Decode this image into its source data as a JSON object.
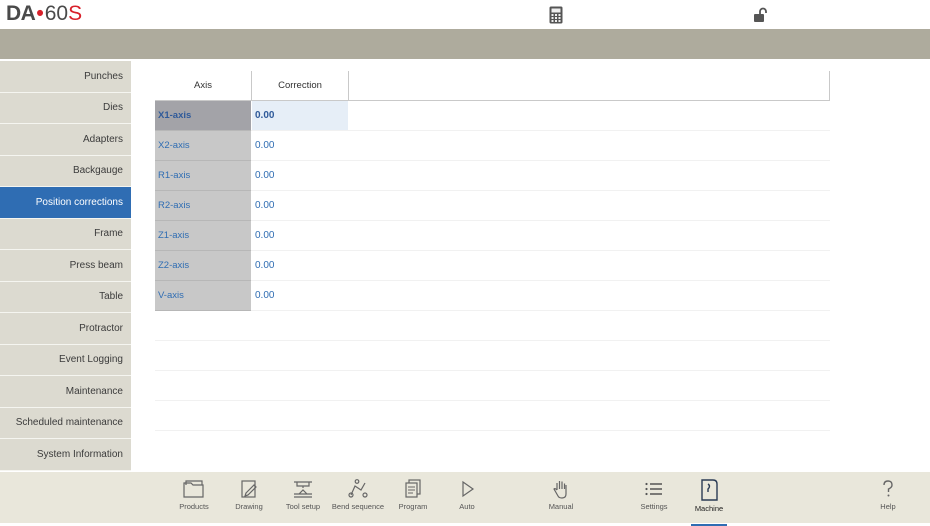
{
  "header": {
    "logo_brand": "DA",
    "logo_dot": "•",
    "logo_number": "60",
    "logo_model": "S",
    "icons": [
      "calculator-icon",
      "unlocked-padlock-icon"
    ]
  },
  "sidebar": {
    "items": [
      {
        "label": "Punches",
        "active": false
      },
      {
        "label": "Dies",
        "active": false
      },
      {
        "label": "Adapters",
        "active": false
      },
      {
        "label": "Backgauge",
        "active": false
      },
      {
        "label": "Position corrections",
        "active": true
      },
      {
        "label": "Frame",
        "active": false
      },
      {
        "label": "Press beam",
        "active": false
      },
      {
        "label": "Table",
        "active": false
      },
      {
        "label": "Protractor",
        "active": false
      },
      {
        "label": "Event Logging",
        "active": false
      },
      {
        "label": "Maintenance",
        "active": false
      },
      {
        "label": "Scheduled maintenance",
        "active": false
      },
      {
        "label": "System Information",
        "active": false
      }
    ]
  },
  "table": {
    "columns": [
      "Axis",
      "Correction"
    ],
    "rows": [
      {
        "axis": "X1-axis",
        "correction": "0.00",
        "selected": true
      },
      {
        "axis": "X2-axis",
        "correction": "0.00",
        "selected": false
      },
      {
        "axis": "R1-axis",
        "correction": "0.00",
        "selected": false
      },
      {
        "axis": "R2-axis",
        "correction": "0.00",
        "selected": false
      },
      {
        "axis": "Z1-axis",
        "correction": "0.00",
        "selected": false
      },
      {
        "axis": "Z2-axis",
        "correction": "0.00",
        "selected": false
      },
      {
        "axis": "V-axis",
        "correction": "0.00",
        "selected": false
      }
    ]
  },
  "bottom_nav": {
    "items": [
      {
        "label": "Products",
        "icon": "folder-icon"
      },
      {
        "label": "Drawing",
        "icon": "pencil-drawing-icon"
      },
      {
        "label": "Tool setup",
        "icon": "tool-setup-icon"
      },
      {
        "label": "Bend sequence",
        "icon": "bend-sequence-icon"
      },
      {
        "label": "Program",
        "icon": "program-pages-icon"
      },
      {
        "label": "Auto",
        "icon": "play-icon"
      },
      {
        "label": "Manual",
        "icon": "hand-icon"
      },
      {
        "label": "Settings",
        "icon": "list-settings-icon"
      },
      {
        "label": "Machine",
        "icon": "machine-icon",
        "active": true
      },
      {
        "label": "Help",
        "icon": "question-mark-icon"
      }
    ]
  },
  "colors": {
    "accent": "#2f6db3",
    "brand_red": "#d8202a",
    "band": "#aeab9d",
    "sidebar_bg": "#dcdad0",
    "bottom_bg": "#e9e7db"
  }
}
